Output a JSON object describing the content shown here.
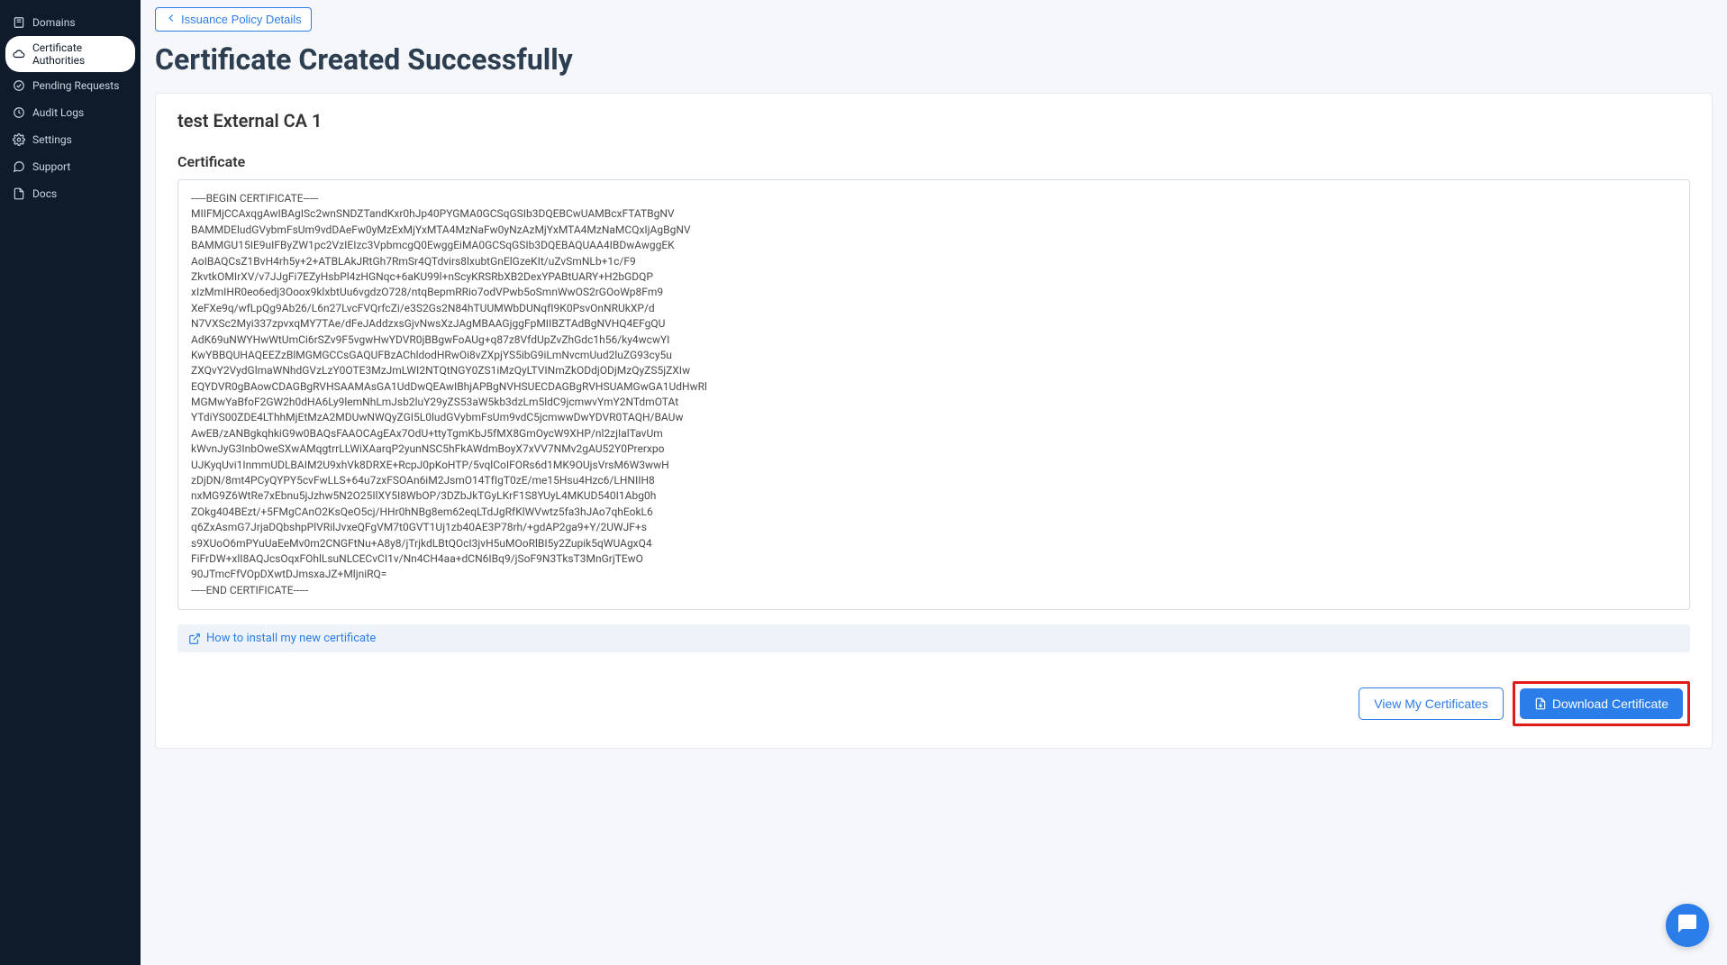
{
  "sidebar": {
    "items": [
      {
        "label": "Domains"
      },
      {
        "label": "Certificate Authorities"
      },
      {
        "label": "Pending Requests"
      },
      {
        "label": "Audit Logs"
      },
      {
        "label": "Settings"
      },
      {
        "label": "Support"
      },
      {
        "label": "Docs"
      }
    ]
  },
  "back_link": "Issuance Policy Details",
  "page_title": "Certificate Created Successfully",
  "card_title": "test External CA 1",
  "cert_heading": "Certificate",
  "cert_body": "-----BEGIN CERTIFICATE-----\nMIIFMjCCAxqgAwIBAgISc2wnSNDZTandKxr0hJp40PYGMA0GCSqGSIb3DQEBCwUAMBcxFTATBgNV\nBAMMDEludGVybmFsUm9vdDAeFw0yMzExMjYxMTA4MzNaFw0yNzAzMjYxMTA4MzNaMCQxIjAgBgNV\nBAMMGU15IE9uIFByZW1pc2VzIEIzc3VpbmcgQ0EwggEiMA0GCSqGSIb3DQEBAQUAA4IBDwAwggEK\nAoIBAQCsZ1BvH4rh5y+2+ATBLAkJRtGh7RmSr4QTdvirs8lxubtGnElGzeKIt/uZvSmNLb+1c/F9\nZkvtkOMIrXV/v7JJgFi7EZyHsbPl4zHGNqc+6aKU99l+nScyKRSRbXB2DexYPABtUARY+H2bGDQP\nxIzMmIHR0eo6edj3Ooox9klxbtUu6vgdzO728/ntqBepmRRio7odVPwb5oSmnWwOS2rGOoWp8Fm9\nXeFXe9q/wfLpQg9Ab26/L6n27LvcFVQrfcZi/e3S2Gs2N84hTUUMWbDUNqfI9K0PsvOnNRUkXP/d\nN7VXSc2Myi337zpvxqMY7TAe/dFeJAddzxsGjvNwsXzJAgMBAAGjggFpMIIBZTAdBgNVHQ4EFgQU\nAdK69uNWYHwWtUmCi6rSZv9F5vgwHwYDVR0jBBgwFoAUg+q87z8VfdUpZvZhGdc1h56/ky4wcwYI\nKwYBBQUHAQEEZzBlMGMGCCsGAQUFBzAChldodHRwOi8vZXpjYS5ibG9iLmNvcmUud2luZG93cy5u\nZXQvY2VydGlmaWNhdGVzLzY0OTE3MzJmLWI2NTQtNGY0ZS1iMzQyLTVINmZkODdjODjMzQyZS5jZXIw\nEQYDVR0gBAowCDAGBgRVHSAAMAsGA1UdDwQEAwIBhjAPBgNVHSUECDAGBgRVHSUAMGwGA1UdHwRl\nMGMwYaBfoF2GW2h0dHA6Ly9lemNhLmJsb2luY29yZS53aW5kb3dzLm5ldC9jcmwvYmY2NTdmOTAt\nYTdiYS00ZDE4LThhMjEtMzA2MDUwNWQyZGI5L0ludGVybmFsUm9vdC5jcmwwDwYDVR0TAQH/BAUw\nAwEB/zANBgkqhkiG9w0BAQsFAAOCAgEAx7OdU+ttyTgmKbJ5fMX8GmOycW9XHP/nl2zjIalTavUm\nkWvnJyG3InbOweSXwAMqgtrrLLWiXAarqP2yunNSC5hFkAWdmBoyX7xVV7NMv2gAU52Y0Prerxpo\nUJKyqUvi1InmmUDLBAIM2U9xhVk8DRXE+RcpJ0pKoHTP/5vqlCoIFORs6d1MK9OUjsVrsM6W3wwH\nzDjDN/8mt4PCyQYPY5cvFwLLS+64u7zxFSOAn6iM2JsmO14TfIgT0zE/me15Hsu4Hzc6/LHNIIH8\nnxMG9Z6WtRe7xEbnu5jJzhw5N2O25IlXY5I8WbOP/3DZbJkTGyLKrF1S8YUyL4MKUD540I1Abg0h\nZOkg404BEzt/+5FMgCAnO2KsQeO5cj/HHr0hNBg8em62eqLTdJgRfKlWVwtz5fa3hJAo7qhEokL6\nq6ZxAsmG7JrjaDQbshpPlVRilJvxeQFgVM7t0GVT1Uj1zb40AE3P78rh/+gdAP2ga9+Y/2UWJF+s\ns9XUoO6mPYuUaEeMv0m2CNGFtNu+A8y8/jTrjkdLBtQOcI3jvH5uMOoRlBI5y2Zupik5qWUAgxQ4\nFiFrDW+xlI8AQJcsOqxFOhlLsuNLCECvCI1v/Nn4CH4aa+dCN6IBq9/jSoF9N3TksT3MnGrjTEwO\n90JTmcFfVOpDXwtDJmsxaJZ+MljniRQ=\n-----END CERTIFICATE-----",
  "help_text": "How to install my new certificate",
  "buttons": {
    "view": "View My Certificates",
    "download": "Download Certificate"
  }
}
